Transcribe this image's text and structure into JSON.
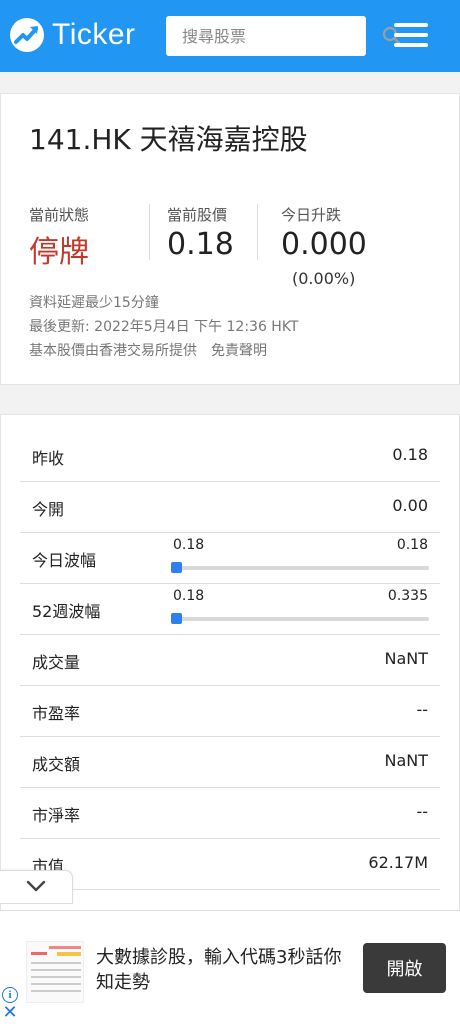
{
  "header": {
    "logo_text": "Ticker",
    "search_placeholder": "搜尋股票",
    "accent_color": "#2196f3"
  },
  "quote": {
    "title": "141.HK 天禧海嘉控股",
    "status_label": "當前狀態",
    "status_value": "停牌",
    "price_label": "當前股價",
    "price_value": "0.18",
    "change_label": "今日升跌",
    "change_value": "0.000",
    "change_pct": "(0.00%)",
    "delay_note": "資料延遲最少15分鐘",
    "last_update": "最後更新: 2022年5月4日 下午 12:36 HKT",
    "source_note": "基本股價由香港交易所提供",
    "disclaimer_link": "免責聲明",
    "status_color": "#c0392b"
  },
  "stats": {
    "rows": [
      {
        "label": "昨收",
        "value": "0.18"
      },
      {
        "label": "今開",
        "value": "0.00"
      },
      {
        "label": "今日波幅",
        "min": "0.18",
        "max": "0.18",
        "position": 0
      },
      {
        "label": "52週波幅",
        "min": "0.18",
        "max": "0.335",
        "position": 0
      },
      {
        "label": "成交量",
        "value": "NaNT"
      },
      {
        "label": "市盈率",
        "value": "--"
      },
      {
        "label": "成交額",
        "value": "NaNT"
      },
      {
        "label": "市淨率",
        "value": "--"
      },
      {
        "label": "市值",
        "value": "62.17M"
      }
    ]
  },
  "ad": {
    "text": "大數據診股，輸入代碼3秒話你知走勢",
    "button_label": "開啟",
    "info_glyph": "i",
    "close_glyph": "✕"
  },
  "icons": {
    "logo": "trend-up-icon",
    "search": "search-icon",
    "menu": "hamburger-menu-icon",
    "collapse": "chevron-down-icon",
    "ad_info": "info-icon",
    "ad_close": "close-icon"
  }
}
